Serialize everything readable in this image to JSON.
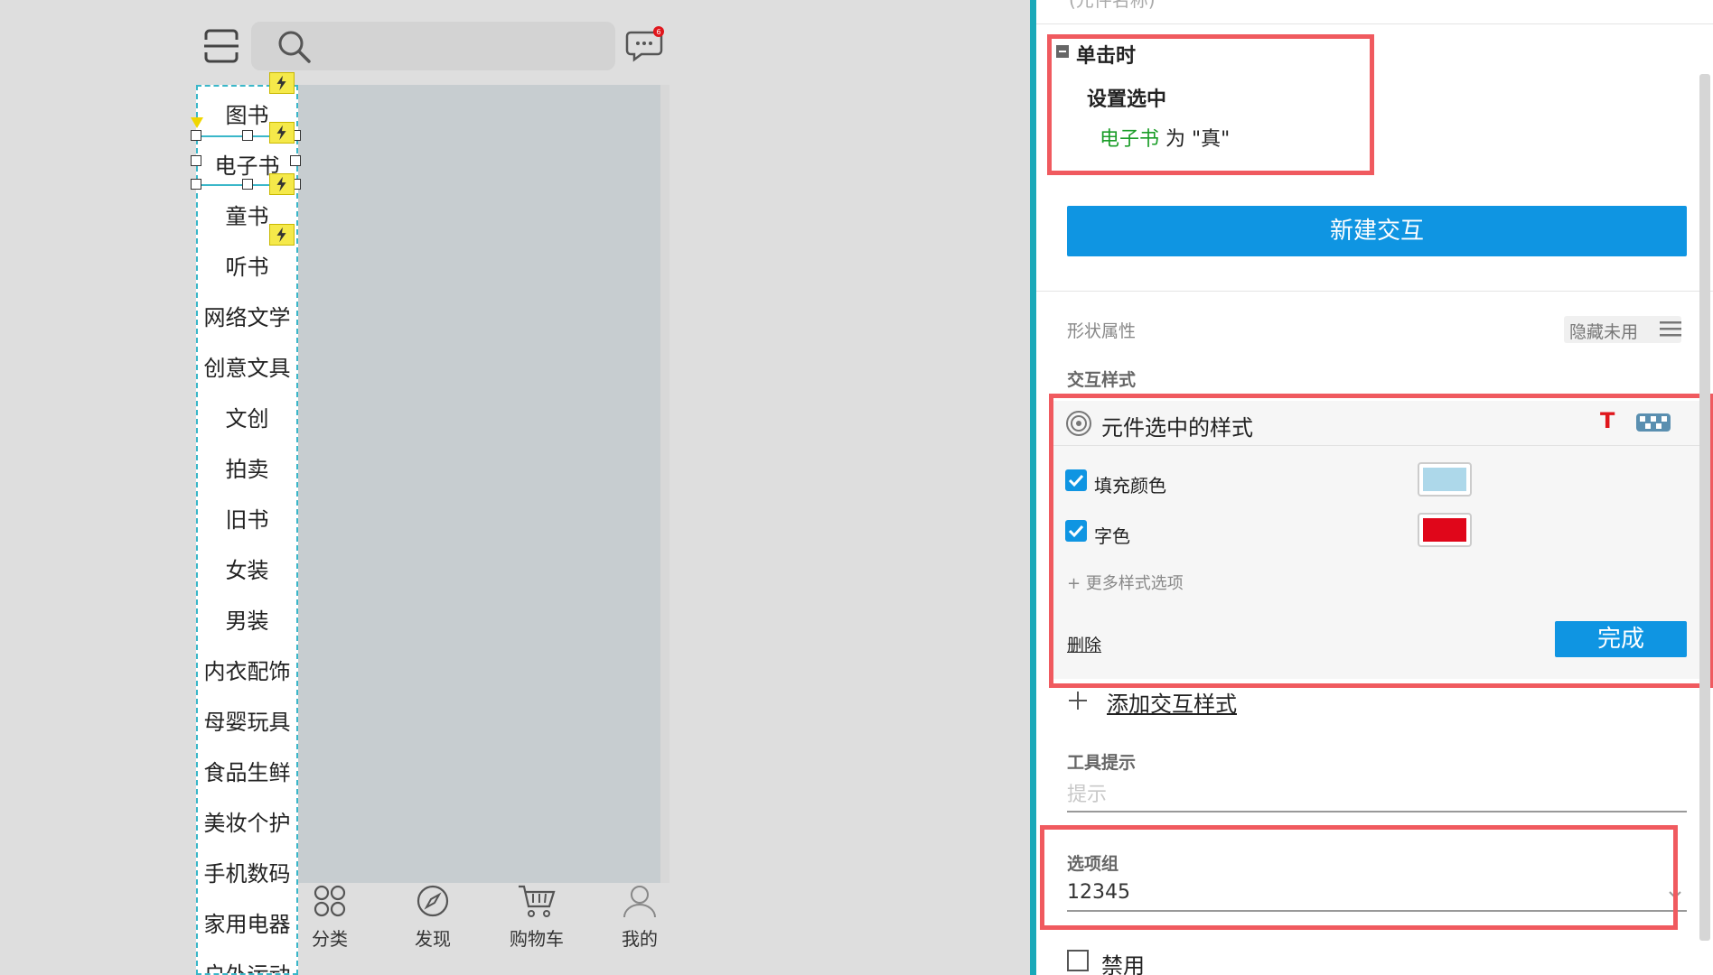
{
  "canvas": {
    "categories": [
      "图书",
      "电子书",
      "童书",
      "听书",
      "网络文学",
      "创意文具",
      "文创",
      "拍卖",
      "旧书",
      "女装",
      "男装",
      "内衣配饰",
      "母婴玩具",
      "食品生鲜",
      "美妆个护",
      "手机数码",
      "家用电器",
      "户外运动"
    ],
    "message_badge": "6",
    "bottom_nav": [
      "分类",
      "发现",
      "购物车",
      "我的"
    ]
  },
  "panel": {
    "top_cut_text": "(元件名称)",
    "event": {
      "title": "单击时",
      "action": "设置选中",
      "target": "电子书",
      "detail_rest": " 为 \"真\""
    },
    "new_interaction_button": "新建交互",
    "shape_props_label": "形状属性",
    "hide_unused_label": "隐藏未用",
    "interaction_style_label": "交互样式",
    "style_card": {
      "title": "元件选中的样式",
      "t_icon": "T",
      "fill_label": "填充颜色",
      "fill_color": "#add8ea",
      "font_label": "字色",
      "font_color": "#e0061a",
      "more_options": "+ 更多样式选项",
      "delete": "删除",
      "done": "完成"
    },
    "add_style": "添加交互样式",
    "tooltip_label": "工具提示",
    "tooltip_placeholder": "提示",
    "option_group_label": "选项组",
    "option_group_value": "12345",
    "disable_label": "禁用"
  },
  "colors": {
    "accent": "#0f95e2",
    "highlight_red": "#f05a5f",
    "green_text": "#1a9d28"
  }
}
